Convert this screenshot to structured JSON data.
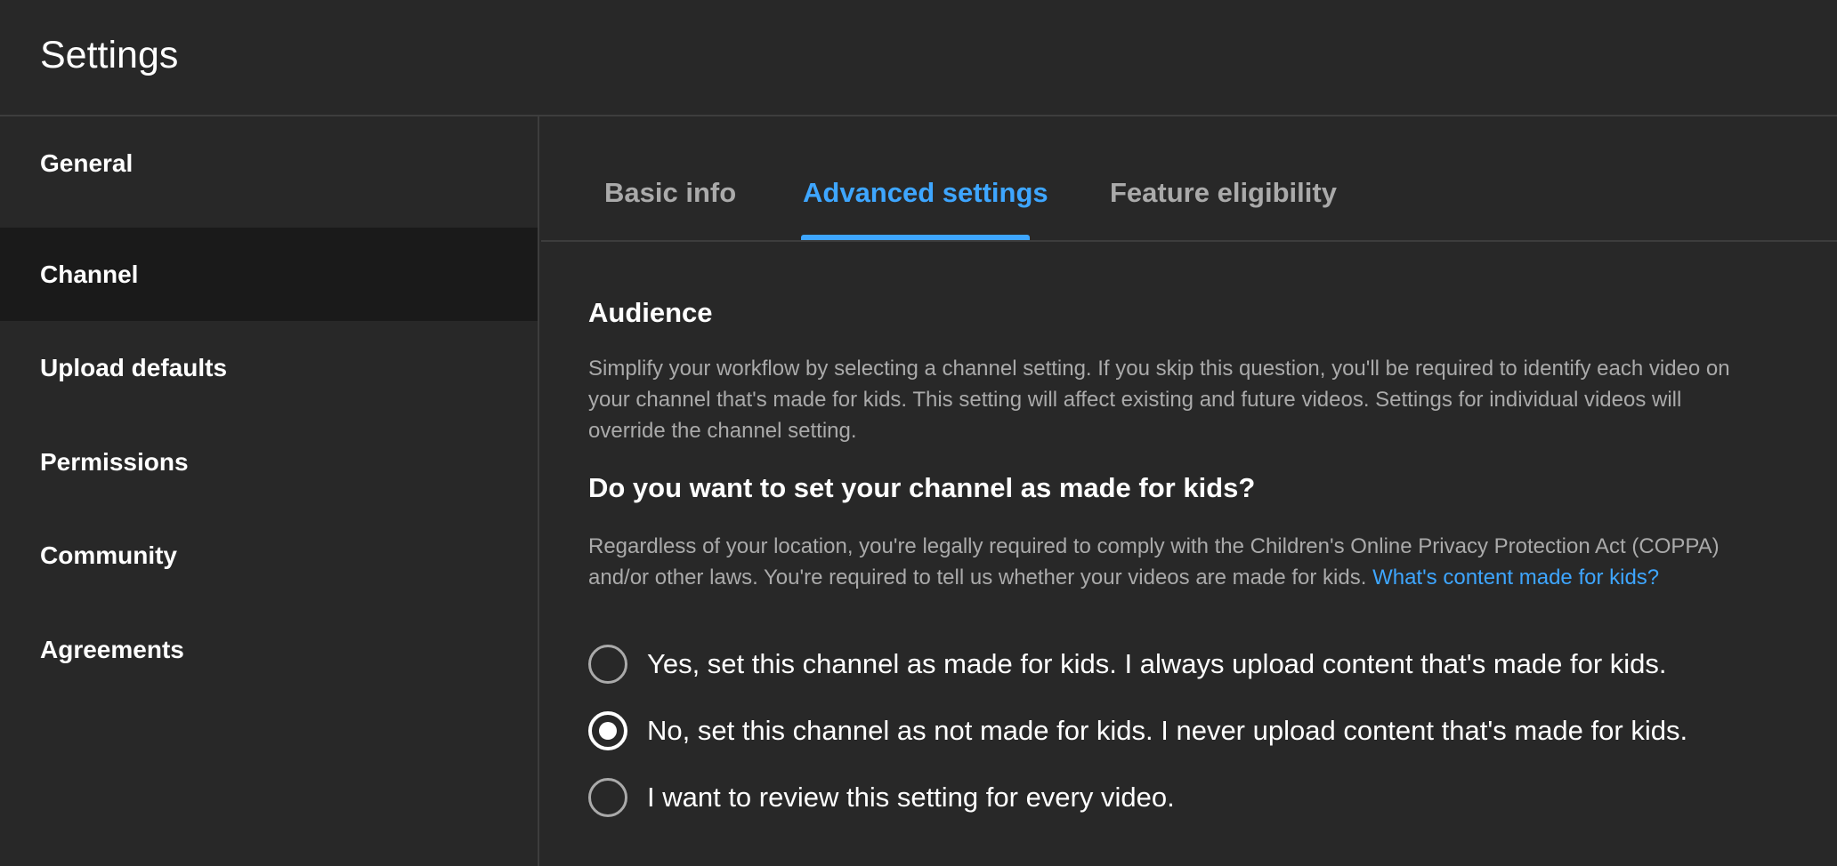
{
  "header": {
    "title": "Settings"
  },
  "sidebar": {
    "items": [
      {
        "label": "General"
      },
      {
        "label": "Channel",
        "active": true
      },
      {
        "label": "Upload defaults"
      },
      {
        "label": "Permissions"
      },
      {
        "label": "Community"
      },
      {
        "label": "Agreements"
      }
    ]
  },
  "tabs": [
    {
      "label": "Basic info"
    },
    {
      "label": "Advanced settings",
      "active": true
    },
    {
      "label": "Feature eligibility"
    }
  ],
  "audience": {
    "title": "Audience",
    "description": "Simplify your workflow by selecting a channel setting. If you skip this question, you'll be required to identify each video on your channel that's made for kids. This setting will affect existing and future videos. Settings for individual videos will override the channel setting.",
    "question": "Do you want to set your channel as made for kids?",
    "legal_text": "Regardless of your location, you're legally required to comply with the Children's Online Privacy Protection Act (COPPA) and/or other laws. You're required to tell us whether your videos are made for kids.",
    "legal_link": "What's content made for kids?",
    "options": [
      {
        "label": "Yes, set this channel as made for kids. I always upload content that's made for kids.",
        "checked": false
      },
      {
        "label": "No, set this channel as not made for kids. I never upload content that's made for kids.",
        "checked": true
      },
      {
        "label": "I want to review this setting for every video.",
        "checked": false
      }
    ]
  },
  "colors": {
    "background": "#282828",
    "active_sidebar": "#1a1a1a",
    "accent": "#3ea6ff",
    "secondary_text": "#aaaaaa"
  }
}
